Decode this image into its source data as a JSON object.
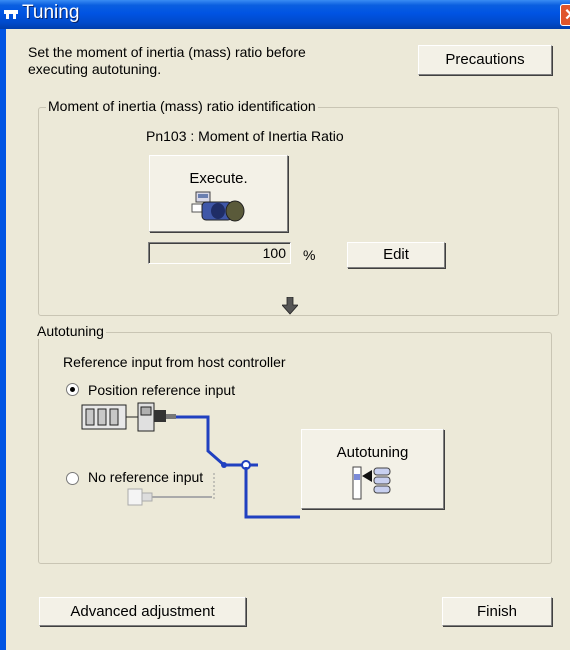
{
  "window": {
    "title": "Tuning"
  },
  "intro": {
    "line1": "Set the moment of inertia (mass) ratio before",
    "line2": "executing autotuning."
  },
  "buttons": {
    "precautions": "Precautions",
    "execute": "Execute.",
    "edit": "Edit",
    "autotuning": "Autotuning",
    "advanced": "Advanced adjustment",
    "finish": "Finish"
  },
  "inertia_group": {
    "legend": "Moment of inertia (mass) ratio identification",
    "param_label": "Pn103 : Moment of Inertia Ratio",
    "value": "100",
    "unit": "%"
  },
  "autotuning_group": {
    "legend": "Autotuning",
    "reference_label": "Reference input from host controller",
    "radio_options": [
      {
        "label": "Position reference input",
        "selected": true
      },
      {
        "label": "No reference input",
        "selected": false
      }
    ]
  },
  "icons": [
    "servo-motor-icon",
    "down-arrow-icon",
    "controller-diagram",
    "autotuning-icon"
  ],
  "colors": {
    "titlebar": "#0054e3",
    "wire": "#2040c0",
    "background": "#ece9d8"
  }
}
